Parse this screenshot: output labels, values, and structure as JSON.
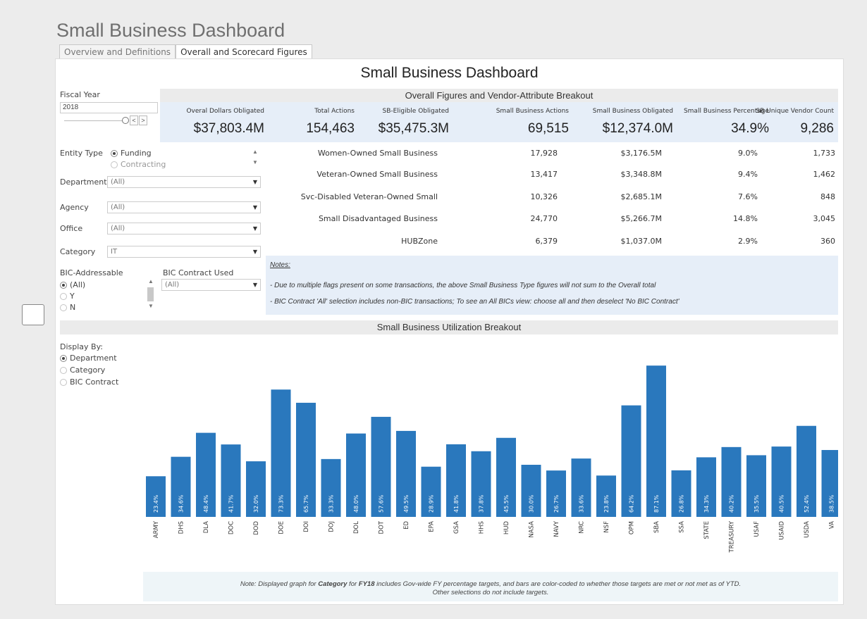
{
  "page_title": "Small Business Dashboard",
  "tabs": [
    {
      "label": "Overview and Definitions",
      "active": false
    },
    {
      "label": "Overall and Scorecard Figures",
      "active": true
    }
  ],
  "dashboard_title": "Small Business Dashboard",
  "filters": {
    "fiscal_year_label": "Fiscal Year",
    "fiscal_year_value": "2018",
    "stepper_prev": "<",
    "stepper_next": ">",
    "entity_type_label": "Entity Type",
    "entity_type_options": [
      "Funding",
      "Contracting"
    ],
    "entity_type_selected": "Funding",
    "department_label": "Department",
    "department_value": "(All)",
    "agency_label": "Agency",
    "agency_value": "(All)",
    "office_label": "Office",
    "office_value": "(All)",
    "category_label": "Category",
    "category_value": "IT",
    "bic_addressable_label": "BIC-Addressable",
    "bic_addressable_options": [
      "(All)",
      "Y",
      "N"
    ],
    "bic_addressable_selected": "(All)",
    "bic_contract_used_label": "BIC Contract Used",
    "bic_contract_used_value": "(All)",
    "caret": "▼"
  },
  "overall": {
    "band_title": "Overall Figures and Vendor-Attribute Breakout",
    "stats": [
      {
        "label": "Overal Dollars Obligated",
        "value": "$37,803.4M"
      },
      {
        "label": "Total Actions",
        "value": "154,463"
      },
      {
        "label": "SB-Eligible Obligated",
        "value": "$35,475.3M"
      },
      {
        "label": "Small Business Actions",
        "value": "69,515"
      },
      {
        "label": "Small Business Obligated",
        "value": "$12,374.0M"
      },
      {
        "label": "Small Business Percentage",
        "value": "34.9%"
      },
      {
        "label": "SB Unique Vendor Count",
        "value": "9,286"
      }
    ],
    "attributes": [
      {
        "name": "Women-Owned Small Business",
        "actions": "17,928",
        "obligated": "$3,176.5M",
        "percentage": "9.0%",
        "vendors": "1,733"
      },
      {
        "name": "Veteran-Owned Small Business",
        "actions": "13,417",
        "obligated": "$3,348.8M",
        "percentage": "9.4%",
        "vendors": "1,462"
      },
      {
        "name": "Svc-Disabled Veteran-Owned Small",
        "actions": "10,326",
        "obligated": "$2,685.1M",
        "percentage": "7.6%",
        "vendors": "848"
      },
      {
        "name": "Small Disadvantaged Business",
        "actions": "24,770",
        "obligated": "$5,266.7M",
        "percentage": "14.8%",
        "vendors": "3,045"
      },
      {
        "name": "HUBZone",
        "actions": "6,379",
        "obligated": "$1,037.0M",
        "percentage": "2.9%",
        "vendors": "360"
      }
    ]
  },
  "notes": {
    "heading": "Notes:",
    "lines": [
      "- Due to multiple flags present on some transactions, the above Small Business Type figures will not sum to the Overall total",
      "- BIC Contract 'All' selection includes non-BIC transactions; To see an All BICs view: choose all and then deselect 'No BIC Contract'"
    ]
  },
  "utilization": {
    "band_title": "Small Business Utilization Breakout",
    "display_by_label": "Display By:",
    "display_by_options": [
      "Department",
      "Category",
      "BIC Contract"
    ],
    "display_by_selected": "Department"
  },
  "footnote": {
    "line1_pre": "Note:  Displayed graph for ",
    "line1_b1": "Category",
    "line1_mid": " for ",
    "line1_b2": "FY18",
    "line1_post": " includes Gov-wide FY percentage targets, and bars are color-coded to whether those targets are met or not met as of YTD.",
    "line2": "Other selections do not include targets."
  },
  "colors": {
    "bar": "#2a78bd",
    "band": "#ebebeb",
    "stats_bg": "#e6eef8"
  },
  "chart_data": {
    "type": "bar",
    "categories": [
      "ARMY",
      "DHS",
      "DLA",
      "DOC",
      "DOD",
      "DOE",
      "DOI",
      "DOJ",
      "DOL",
      "DOT",
      "ED",
      "EPA",
      "GSA",
      "HHS",
      "HUD",
      "NASA",
      "NAVY",
      "NRC",
      "NSF",
      "OPM",
      "SBA",
      "SSA",
      "STATE",
      "TREASURY",
      "USAF",
      "USAID",
      "USDA",
      "VA"
    ],
    "values": [
      23.4,
      34.6,
      48.4,
      41.7,
      32.0,
      73.3,
      65.7,
      33.3,
      48.0,
      57.6,
      49.5,
      28.9,
      41.8,
      37.8,
      45.5,
      30.0,
      26.7,
      33.6,
      23.8,
      64.2,
      87.1,
      26.8,
      34.3,
      40.2,
      35.5,
      40.5,
      52.4,
      38.5
    ],
    "labels": [
      "23.4%",
      "34.6%",
      "48.4%",
      "41.7%",
      "32.0%",
      "73.3%",
      "65.7%",
      "33.3%",
      "48.0%",
      "57.6%",
      "49.5%",
      "28.9%",
      "41.8%",
      "37.8%",
      "45.5%",
      "30.0%",
      "26.7%",
      "33.6%",
      "23.8%",
      "64.2%",
      "87.1%",
      "26.8%",
      "34.3%",
      "40.2%",
      "35.5%",
      "40.5%",
      "52.4%",
      "38.5%"
    ],
    "ylim": [
      0,
      90
    ]
  }
}
